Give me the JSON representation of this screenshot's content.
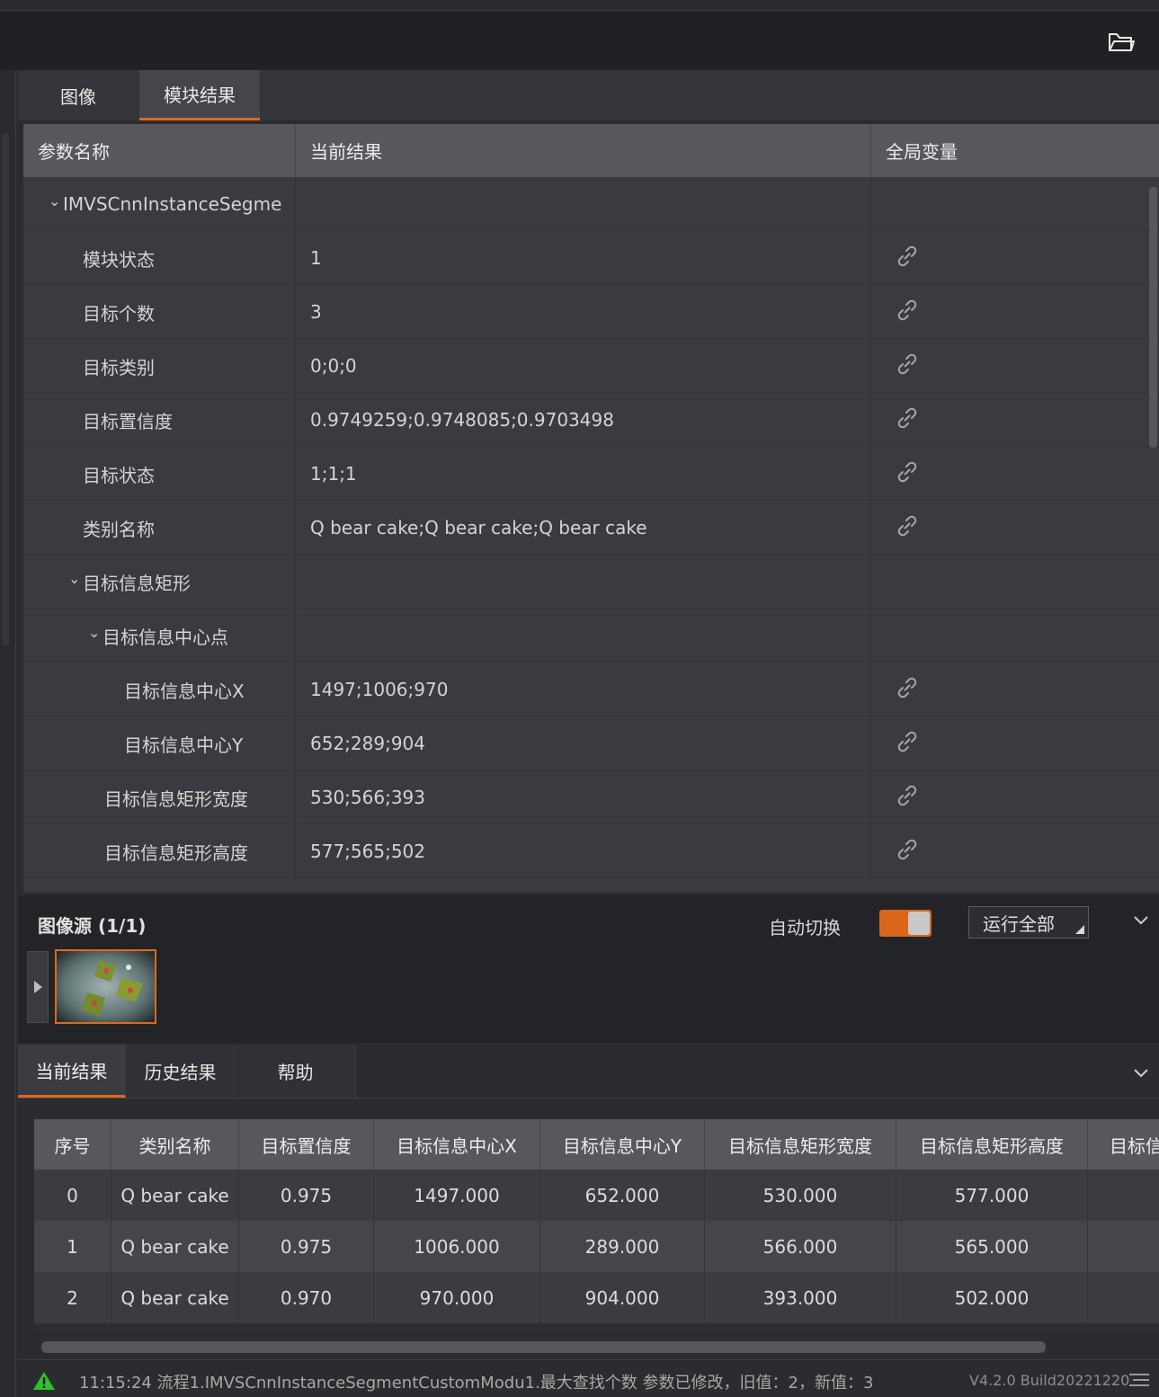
{
  "tabs_top": [
    "图像",
    "模块结果"
  ],
  "param_table": {
    "headers": [
      "参数名称",
      "当前结果",
      "全局变量"
    ],
    "rows": [
      {
        "name": "IMVSCnnInstanceSegme",
        "value": "",
        "level": 0,
        "expand": true,
        "link": false
      },
      {
        "name": "模块状态",
        "value": "1",
        "level": 1,
        "expand": false,
        "link": true
      },
      {
        "name": "目标个数",
        "value": "3",
        "level": 1,
        "expand": false,
        "link": true
      },
      {
        "name": "目标类别",
        "value": "0;0;0",
        "level": 1,
        "expand": false,
        "link": true
      },
      {
        "name": "目标置信度",
        "value": "0.9749259;0.9748085;0.9703498",
        "level": 1,
        "expand": false,
        "link": true
      },
      {
        "name": "目标状态",
        "value": "1;1;1",
        "level": 1,
        "expand": false,
        "link": true
      },
      {
        "name": "类别名称",
        "value": "Q bear cake;Q bear cake;Q bear cake",
        "level": 1,
        "expand": false,
        "link": true
      },
      {
        "name": "目标信息矩形",
        "value": "",
        "level": 1,
        "expand": true,
        "link": false
      },
      {
        "name": "目标信息中心点",
        "value": "",
        "level": 2,
        "expand": true,
        "link": false
      },
      {
        "name": "目标信息中心X",
        "value": "1497;1006;970",
        "level": 3,
        "expand": false,
        "link": true
      },
      {
        "name": "目标信息中心Y",
        "value": "652;289;904",
        "level": 3,
        "expand": false,
        "link": true
      },
      {
        "name": "目标信息矩形宽度",
        "value": "530;566;393",
        "level": 2,
        "expand": false,
        "link": true
      },
      {
        "name": "目标信息矩形高度",
        "value": "577;565;502",
        "level": 2,
        "expand": false,
        "link": true
      }
    ]
  },
  "image_source": {
    "title": "图像源 (1/1)",
    "auto_switch_label": "自动切换",
    "auto_switch_on": true,
    "run_all_label": "运行全部"
  },
  "tabs_bottom": [
    "当前结果",
    "历史结果",
    "帮助"
  ],
  "result_grid": {
    "headers": [
      "序号",
      "类别名称",
      "目标置信度",
      "目标信息中心X",
      "目标信息中心Y",
      "目标信息矩形宽度",
      "目标信息矩形高度",
      "目标信"
    ],
    "rows": [
      [
        "0",
        "Q bear cake",
        "0.975",
        "1497.000",
        "652.000",
        "530.000",
        "577.000",
        ""
      ],
      [
        "1",
        "Q bear cake",
        "0.975",
        "1006.000",
        "289.000",
        "566.000",
        "565.000",
        ""
      ],
      [
        "2",
        "Q bear cake",
        "0.970",
        "970.000",
        "904.000",
        "393.000",
        "502.000",
        ""
      ]
    ]
  },
  "status": {
    "message": "11:15:24 流程1.IMVSCnnInstanceSegmentCustomModu1.最大查找个数 参数已修改，旧值：2，新值：3",
    "version": "V4.2.0 Build20221220"
  },
  "colors": {
    "accent": "#e0691d",
    "warning": "#2fbf2f"
  }
}
